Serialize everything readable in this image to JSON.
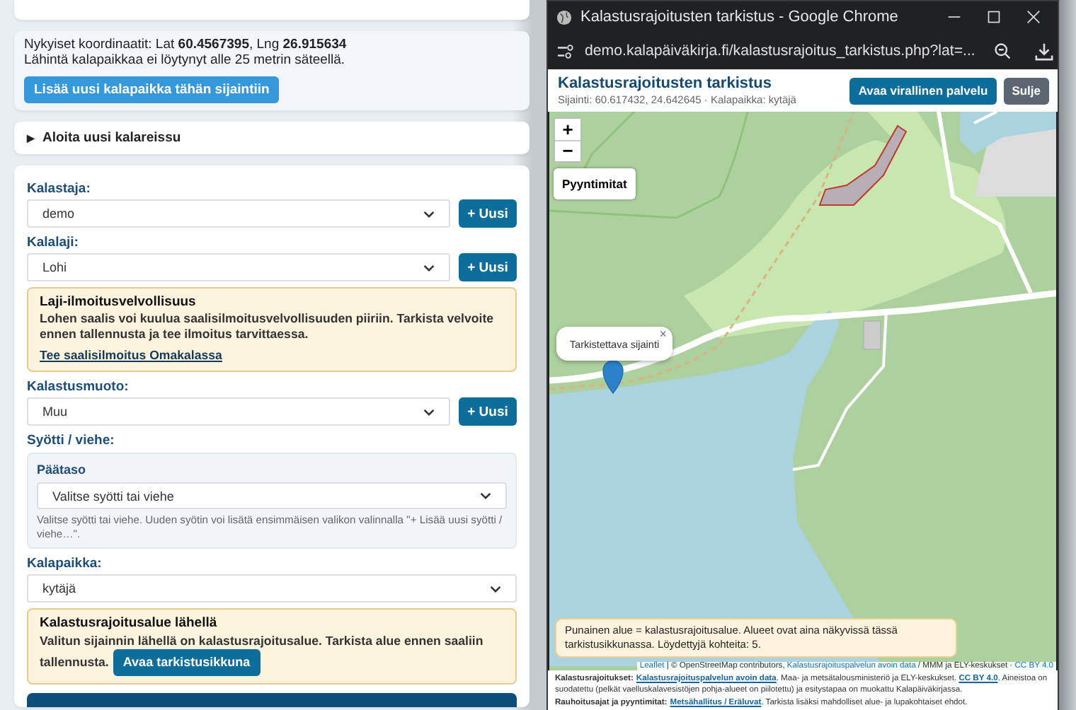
{
  "location": {
    "coordinates": "Nykyiset koordinaatit: Lat **60.4567395**, Lng **26.915634**",
    "note": "Lähintä kalapaikkaa ei löytynyt alle 25 metrin säteellä.",
    "button": "Lisää uusi kalapaikka tähän sijaintiin"
  },
  "trip": {
    "marker": "▶",
    "summary": "Aloita uusi kalareissu"
  },
  "form": {
    "items": [
      {
        "kind": "select",
        "label": "Kalastaja:",
        "value": "demo",
        "button": "+ Uusi"
      },
      {
        "kind": "select",
        "label": "Kalalaji:",
        "value": "Lohi",
        "button": "+ Uusi"
      },
      {
        "kind": "notice",
        "title": "Laji-ilmoitusvelvollisuus",
        "text": "Lohen saalis voi kuulua saalisilmoitusvelvollisuuden piiriin. Tarkista velvoite ennen tallennusta ja tee ilmoitus tarvittaessa.",
        "link": "Tee saalisilmoitus Omakalassa"
      },
      {
        "kind": "select",
        "label": "Kalastusmuoto:",
        "value": "Muu",
        "button": "+ Uusi"
      },
      {
        "kind": "group",
        "label": "Syötti / viehe:",
        "sublabel": "Päätaso",
        "value": "Valitse syötti tai viehe",
        "hint": "Valitse syötti tai viehe. Uuden syötin voi lisätä ensimmäisen valikon valinnalla \"+ Lisää uusi syötti / viehe…\"."
      },
      {
        "kind": "select",
        "label": "Kalapaikka:",
        "value": "kytäjä"
      },
      {
        "kind": "notice",
        "title": "Kalastusrajoitusalue lähellä",
        "text": "Valitun sijainnin lähellä on kalastusrajoitusalue. Tarkista alue ennen saaliin tallennusta.",
        "button": "Avaa tarkistusikkuna"
      }
    ]
  },
  "window": {
    "title": "Kalastusrajoitusten tarkistus - Google Chrome",
    "url": "demo.kalapäiväkirja.fi/kalastusrajoitus_tarkistus.php?lat=...",
    "header": {
      "title": "Kalastusrajoitusten tarkistus",
      "subtitle": "Sijainti: 60.617432, 24.642645 · Kalapaikka: kytäjä",
      "buttons": [
        {
          "kind": "primary",
          "label": "Avaa virallinen palvelu"
        },
        {
          "kind": "secondary",
          "label": "Sulje"
        }
      ]
    },
    "map": {
      "zoom_in": "+",
      "zoom_out": "−",
      "layer_button": "Pyyntimitat",
      "popup": {
        "text": "Tarkistettava sijainti",
        "close": "×"
      },
      "info": "Punainen alue = kalastusrajoitusalue. Alueet ovat aina näkyvissä tässä tarkistusikkunassa. Löydettyjä kohteita: 5.",
      "attribution": [
        {
          "kind": "link",
          "text": "Leaflet"
        },
        {
          "kind": "plain",
          "text": " | © OpenStreetMap contributors, "
        },
        {
          "kind": "link",
          "text": "Kalastusrajoituspalvelun avoin data"
        },
        {
          "kind": "plain",
          "text": " / MMM ja ELY-keskukset · "
        },
        {
          "kind": "link",
          "text": "CC BY 4.0"
        }
      ]
    },
    "footer": [
      [
        {
          "kind": "bold",
          "text": "Kalastusrajoitukset:"
        },
        {
          "kind": "link",
          "text": "Kalastusrajoituspalvelun avoin data"
        },
        {
          "kind": "plain",
          "text": ". Maa- ja metsätalousministeriö ja ELY-keskukset. "
        },
        {
          "kind": "link",
          "text": "CC BY 4.0"
        },
        {
          "kind": "plain",
          "text": ". Aineistoa on suodatettu (pelkät vaelluskalavesistöjen pohja-alueet on piilotettu) ja esitystapaa on muokattu Kalapäiväkirjassa."
        }
      ],
      [
        {
          "kind": "bold",
          "text": "Rauhoitusajat ja pyyntimitat:"
        },
        {
          "kind": "link",
          "text": "Metsähallitus / Eräluvat"
        },
        {
          "kind": "plain",
          "text": ". Tarkista lisäksi mahdolliset alue- ja lupakohtaiset ehdot."
        }
      ]
    ]
  }
}
